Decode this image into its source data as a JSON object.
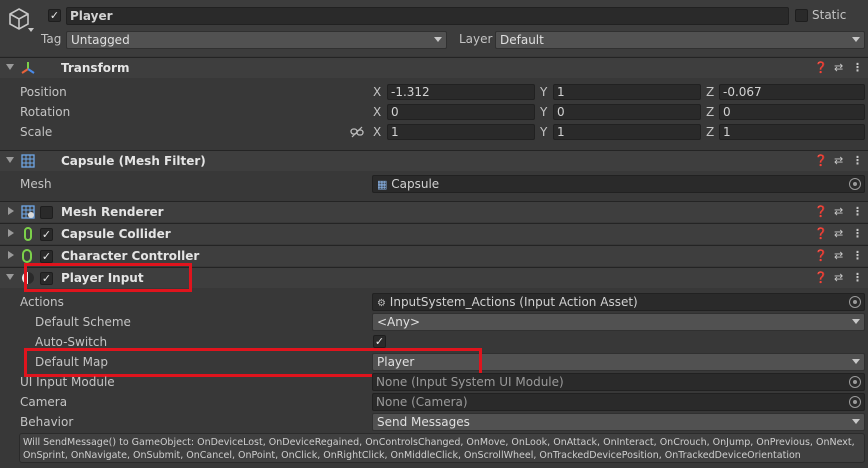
{
  "gameobject": {
    "name": "Player",
    "static_label": "Static",
    "tag_label": "Tag",
    "tag_value": "Untagged",
    "layer_label": "Layer",
    "layer_value": "Default"
  },
  "transform": {
    "title": "Transform",
    "position_label": "Position",
    "rotation_label": "Rotation",
    "scale_label": "Scale",
    "axes": [
      "X",
      "Y",
      "Z"
    ],
    "position": [
      "-1.312",
      "1",
      "-0.067"
    ],
    "rotation": [
      "0",
      "0",
      "0"
    ],
    "scale": [
      "1",
      "1",
      "1"
    ]
  },
  "mesh_filter": {
    "title": "Capsule (Mesh Filter)",
    "mesh_label": "Mesh",
    "mesh_value": "Capsule"
  },
  "mesh_renderer": {
    "title": "Mesh Renderer"
  },
  "capsule_collider": {
    "title": "Capsule Collider"
  },
  "character_controller": {
    "title": "Character Controller"
  },
  "player_input": {
    "title": "Player Input",
    "actions_label": "Actions",
    "actions_value": "InputSystem_Actions (Input Action Asset)",
    "default_scheme_label": "Default Scheme",
    "default_scheme_value": "<Any>",
    "auto_switch_label": "Auto-Switch",
    "default_map_label": "Default Map",
    "default_map_value": "Player",
    "ui_input_module_label": "UI Input Module",
    "ui_input_module_value": "None (Input System UI Module)",
    "camera_label": "Camera",
    "camera_value": "None (Camera)",
    "behavior_label": "Behavior",
    "behavior_value": "Send Messages",
    "info_line1": "Will SendMessage() to GameObject: OnDeviceLost, OnDeviceRegained, OnControlsChanged, OnMove, OnLook, OnAttack, OnInteract, OnCrouch, OnJump, OnPrevious, OnNext,",
    "info_line2": "OnSprint, OnNavigate, OnSubmit, OnCancel, OnPoint, OnClick, OnRightClick, OnMiddleClick, OnScrollWheel, OnTrackedDevicePosition, OnTrackedDeviceOrientation"
  },
  "colors": {
    "highlight": "#e0141d",
    "background": "#383838",
    "header": "#3e3e3e"
  }
}
